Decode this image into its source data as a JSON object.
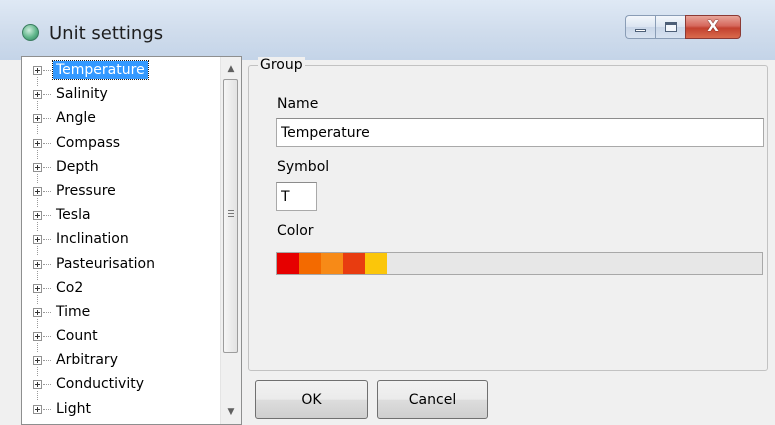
{
  "window": {
    "title": "Unit settings",
    "icon": "globe-icon",
    "caption_buttons": {
      "minimize_icon": "minimize-icon",
      "maximize_icon": "maximize-icon",
      "close_icon": "close-icon",
      "close_glyph": "X"
    }
  },
  "tree": {
    "items": [
      {
        "label": "Temperature",
        "selected": true
      },
      {
        "label": "Salinity"
      },
      {
        "label": "Angle"
      },
      {
        "label": "Compass"
      },
      {
        "label": "Depth"
      },
      {
        "label": "Pressure"
      },
      {
        "label": "Tesla"
      },
      {
        "label": "Inclination"
      },
      {
        "label": "Pasteurisation"
      },
      {
        "label": "Co2"
      },
      {
        "label": "Time"
      },
      {
        "label": "Count"
      },
      {
        "label": "Arbitrary"
      },
      {
        "label": "Conductivity"
      },
      {
        "label": "Light"
      }
    ],
    "scrollbar": {
      "up_arrow": "▲",
      "down_arrow": "▼"
    }
  },
  "group": {
    "title": "Group",
    "name_label": "Name",
    "name_value": "Temperature",
    "symbol_label": "Symbol",
    "symbol_value": "T",
    "color_label": "Color",
    "color_swatches": [
      "#e60000",
      "#f36a00",
      "#f78a17",
      "#e83c10",
      "#fbc60a"
    ]
  },
  "buttons": {
    "ok_label": "OK",
    "cancel_label": "Cancel"
  }
}
